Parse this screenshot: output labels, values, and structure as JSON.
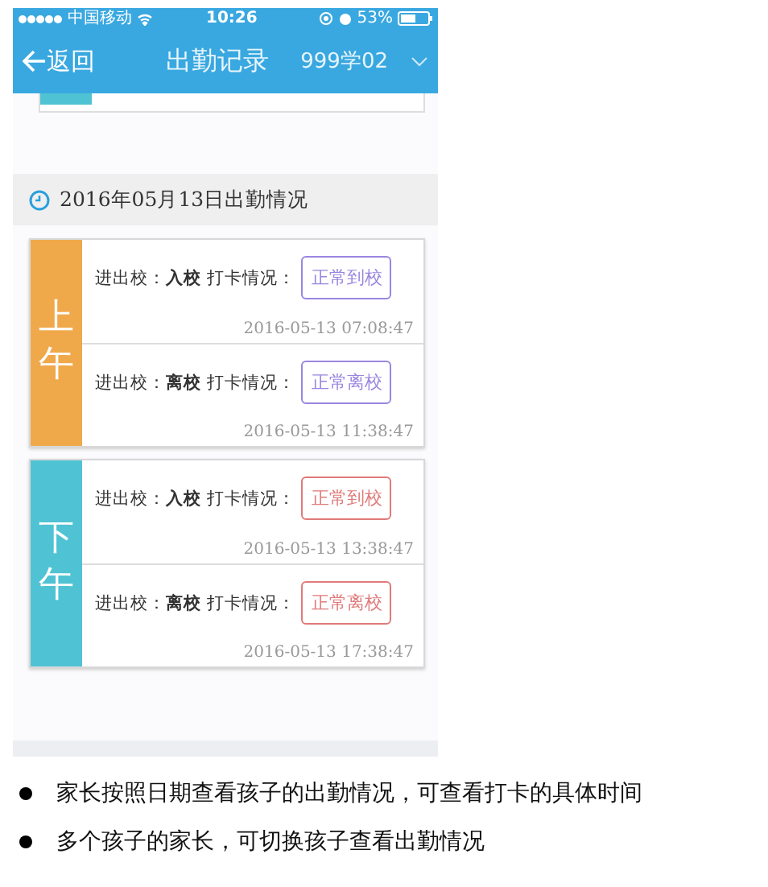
{
  "status_bar": {
    "carrier": "中国移动",
    "time": "10:26",
    "battery": "53%"
  },
  "nav": {
    "back": "返回",
    "title": "出勤记录",
    "student": "999学02"
  },
  "date_header": "2016年05月13日出勤情况",
  "periods": [
    {
      "label": "上午",
      "color": "#f0a94a",
      "records": [
        {
          "text": "进出校：**入校** 打卡情况：",
          "status": "正常到校",
          "color": "#9a86e0",
          "time": "2016-05-13 07:08:47"
        },
        {
          "text": "进出校：**离校** 打卡情况：",
          "status": "正常离校",
          "color": "#9a86e0",
          "time": "2016-05-13 11:38:47"
        }
      ]
    },
    {
      "label": "下午",
      "color": "#4fc3d3",
      "records": [
        {
          "text": "进出校：**入校** 打卡情况：",
          "status": "正常到校",
          "color": "#e07a7a",
          "time": "2016-05-13 13:38:47"
        },
        {
          "text": "进出校：**离校** 打卡情况：",
          "status": "正常离校",
          "color": "#e07a7a",
          "time": "2016-05-13 17:38:47"
        }
      ]
    }
  ],
  "notes": [
    "家长按照日期查看孩子的出勤情况，可查看打卡的具体时间",
    "多个孩子的家长，可切换孩子查看出勤情况"
  ]
}
